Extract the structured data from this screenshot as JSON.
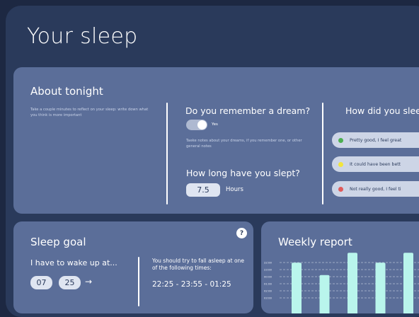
{
  "page": {
    "title": "Your sleep"
  },
  "about_tonight": {
    "title": "About tonight",
    "description": "Take a couple minutes  to reflect on your sleep: write down what you think is more important",
    "dream": {
      "question": "Do you remember a dream?",
      "toggle_label": "Yes",
      "toggle_on": true,
      "notes_hint": "Taeke notes about your dreams, if you remember one, or other general notes"
    },
    "duration": {
      "question": "How long have you slept?",
      "value": "7.5",
      "unit": "Hours"
    },
    "feeling": {
      "question": "How did you sleep",
      "options": [
        {
          "label": "Pretty good, I feel great",
          "color": "#4caf50"
        },
        {
          "label": "It could have been bett",
          "color": "#f2e53c"
        },
        {
          "label": "Not really good, I feel ti",
          "color": "#e05a5a"
        }
      ]
    }
  },
  "sleep_goal": {
    "title": "Sleep goal",
    "help_icon": "?",
    "wake_label": "I have to wake up at...",
    "hour": "07",
    "minute": "25",
    "arrow": "→",
    "advice": "You should try to fall asleep at one of the following times:",
    "times": "22:25 - 23:55 - 01:25"
  },
  "weekly_report": {
    "title": "Weekly report"
  },
  "chart_data": {
    "type": "bar",
    "title": "Weekly report",
    "y_ticks": [
      "22:00",
      "23:00",
      "00:00",
      "01:00",
      "02:00",
      "03:00"
    ],
    "categories": [
      "",
      "",
      "",
      "",
      ""
    ],
    "values": [
      4.1,
      3.1,
      4.9,
      4.1,
      4.9
    ],
    "ylim": [
      0,
      6
    ],
    "bar_color": "#b9f5ec",
    "grid": "dashed-horizontal"
  },
  "colors": {
    "background": "#1d2842",
    "frame": "#2a3a5b",
    "card": "#5b6e99",
    "chart_bar": "#b9f5ec"
  }
}
